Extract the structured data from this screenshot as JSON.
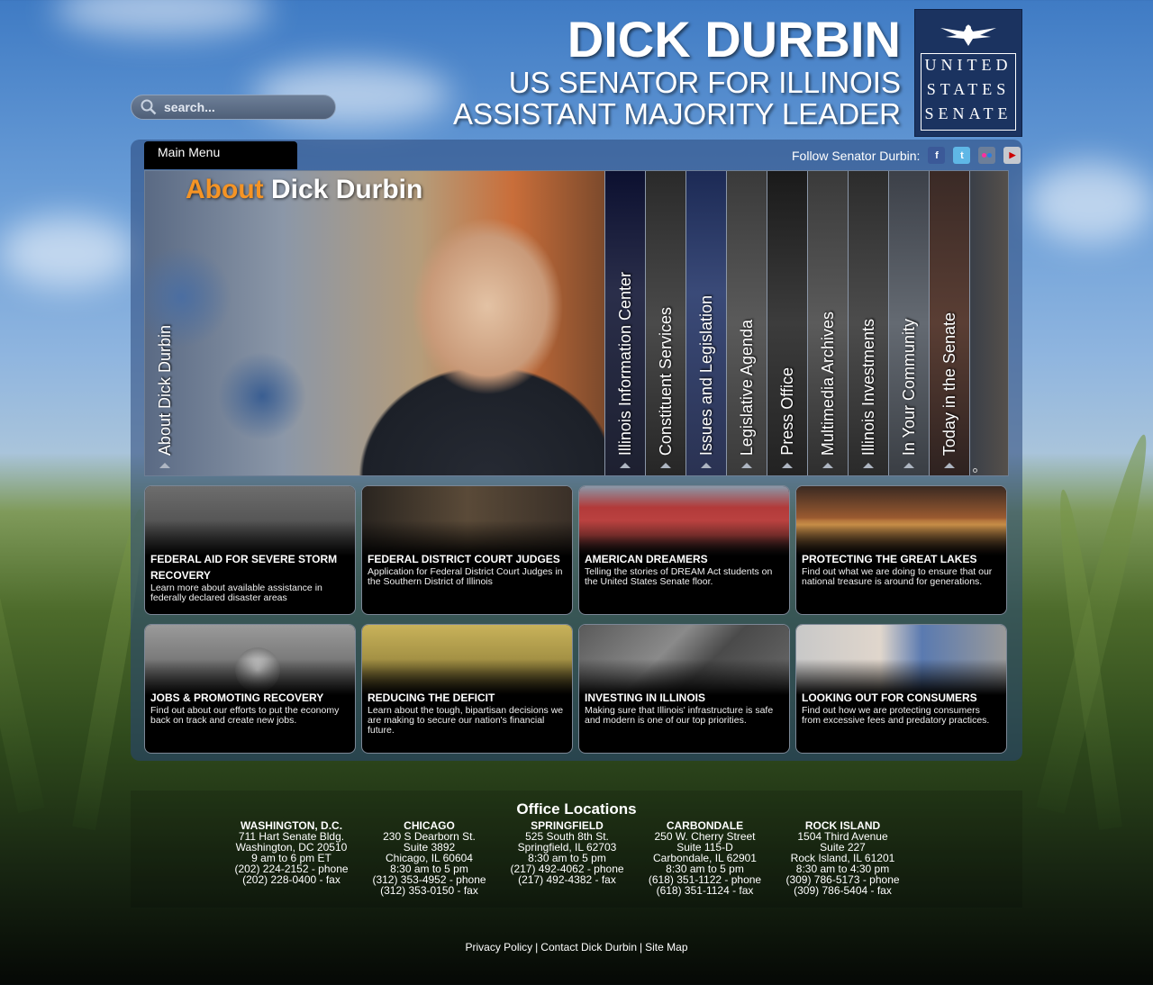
{
  "header": {
    "name": "DICK DURBIN",
    "line1": "US SENATOR FOR ILLINOIS",
    "line2": "ASSISTANT MAJORITY LEADER",
    "senate_logo": [
      "UNITED",
      "STATES",
      "SENATE"
    ]
  },
  "search": {
    "placeholder": "search..."
  },
  "main_menu": {
    "label": "Main Menu"
  },
  "follow": {
    "label": "Follow Senator Durbin:",
    "icons": [
      "facebook-icon",
      "twitter-icon",
      "flickr-icon",
      "youtube-icon"
    ]
  },
  "feature": {
    "title_accent": "About",
    "title_rest": "Dick Durbin",
    "about_tab": "About Dick Durbin",
    "tabs": [
      "Illinois Information Center",
      "Constituent Services",
      "Issues and Legislation",
      "Legislative Agenda",
      "Press Office",
      "Multimedia Archives",
      "Illinois Investments",
      "In Your Community",
      "Today in the Senate"
    ]
  },
  "cards": [
    {
      "title": "FEDERAL AID FOR SEVERE STORM RECOVERY",
      "desc": "Learn more about available assistance in federally declared disaster areas"
    },
    {
      "title": "FEDERAL DISTRICT COURT JUDGES",
      "desc": "Application for Federal District Court Judges in the Southern District of Illinois"
    },
    {
      "title": "AMERICAN DREAMERS",
      "desc": "Telling the stories of DREAM Act students on the United States Senate floor."
    },
    {
      "title": "PROTECTING THE GREAT LAKES",
      "desc": "Find out what we are doing to ensure that our national treasure is around for generations."
    },
    {
      "title": "JOBS & PROMOTING RECOVERY",
      "desc": "Find out about our efforts to put the economy back on track and create new jobs."
    },
    {
      "title": "REDUCING THE DEFICIT",
      "desc": "Learn about the tough, bipartisan decisions we are making to secure our nation's financial future."
    },
    {
      "title": "INVESTING IN ILLINOIS",
      "desc": "Making sure that Illinois' infrastructure is safe and modern is one of our top priorities."
    },
    {
      "title": "LOOKING OUT FOR CONSUMERS",
      "desc": "Find out how we are protecting consumers from excessive fees and predatory practices."
    }
  ],
  "offices": {
    "title": "Office Locations",
    "list": [
      {
        "city": "WASHINGTON, D.C.",
        "lines": [
          "711 Hart Senate Bldg.",
          "Washington, DC 20510",
          "9 am to 6 pm ET",
          "(202) 224-2152 - phone",
          "(202) 228-0400 - fax"
        ]
      },
      {
        "city": "CHICAGO",
        "lines": [
          "230 S Dearborn St.",
          "Suite 3892",
          "Chicago, IL 60604",
          "8:30 am to 5 pm",
          "(312) 353-4952 - phone",
          "(312) 353-0150 - fax"
        ]
      },
      {
        "city": "SPRINGFIELD",
        "lines": [
          "525 South 8th St.",
          "Springfield, IL 62703",
          "8:30 am to 5 pm",
          "(217) 492-4062 - phone",
          "(217) 492-4382 - fax"
        ]
      },
      {
        "city": "CARBONDALE",
        "lines": [
          "250 W. Cherry Street",
          "Suite 115-D",
          "Carbondale, IL 62901",
          "8:30 am to 5 pm",
          "(618) 351-1122 - phone",
          "(618) 351-1124 - fax"
        ]
      },
      {
        "city": "ROCK ISLAND",
        "lines": [
          "1504 Third Avenue",
          "Suite 227",
          "Rock Island, IL 61201",
          "8:30 am to 4:30 pm",
          "(309) 786-5173 - phone",
          "(309) 786-5404 - fax"
        ]
      }
    ]
  },
  "footer": {
    "links": [
      "Privacy Policy",
      "Contact Dick Durbin",
      "Site Map"
    ],
    "separator": "|"
  }
}
